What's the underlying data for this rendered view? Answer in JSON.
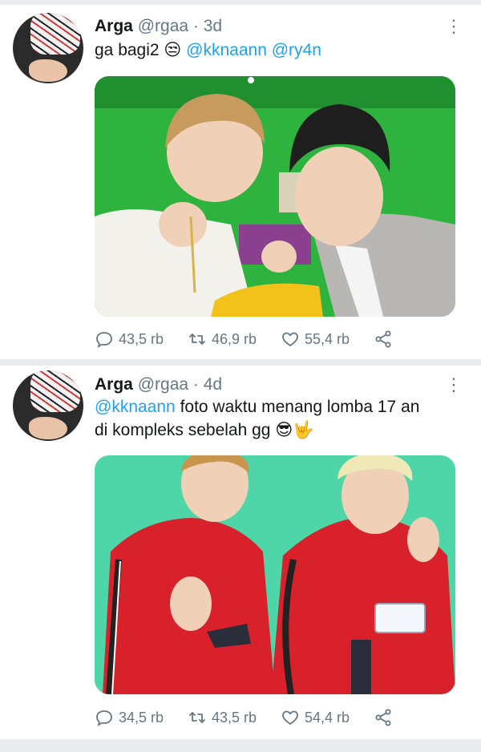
{
  "tweets": [
    {
      "author_name": "Arga",
      "handle": "@rgaa",
      "separator": "·",
      "time_ago": "3d",
      "text_plain": "ga bagi2",
      "emoji": "😒",
      "mentions": [
        "@kknaann",
        "@ry4n"
      ],
      "text_after": "",
      "replies": "43,5 rb",
      "retweets": "46,9 rb",
      "likes": "55,4 rb"
    },
    {
      "author_name": "Arga",
      "handle": "@rgaa",
      "separator": "·",
      "time_ago": "4d",
      "mention_lead": "@kknaann",
      "text_line1": "foto waktu menang lomba 17 an",
      "text_line2": "di kompleks sebelah gg",
      "emoji": "😎🤟",
      "replies": "34,5 rb",
      "retweets": "43,5 rb",
      "likes": "54,4 rb"
    }
  ],
  "icons": {
    "reply": "reply-icon",
    "retweet": "retweet-icon",
    "like": "heart-icon",
    "share": "share-icon",
    "more": "more-vertical-icon"
  },
  "colors": {
    "link": "#1da1f2",
    "muted": "#657786",
    "green_screen": "#2fb33f",
    "mint_bg": "#4fd6a8",
    "jacket_red": "#d8212a"
  }
}
